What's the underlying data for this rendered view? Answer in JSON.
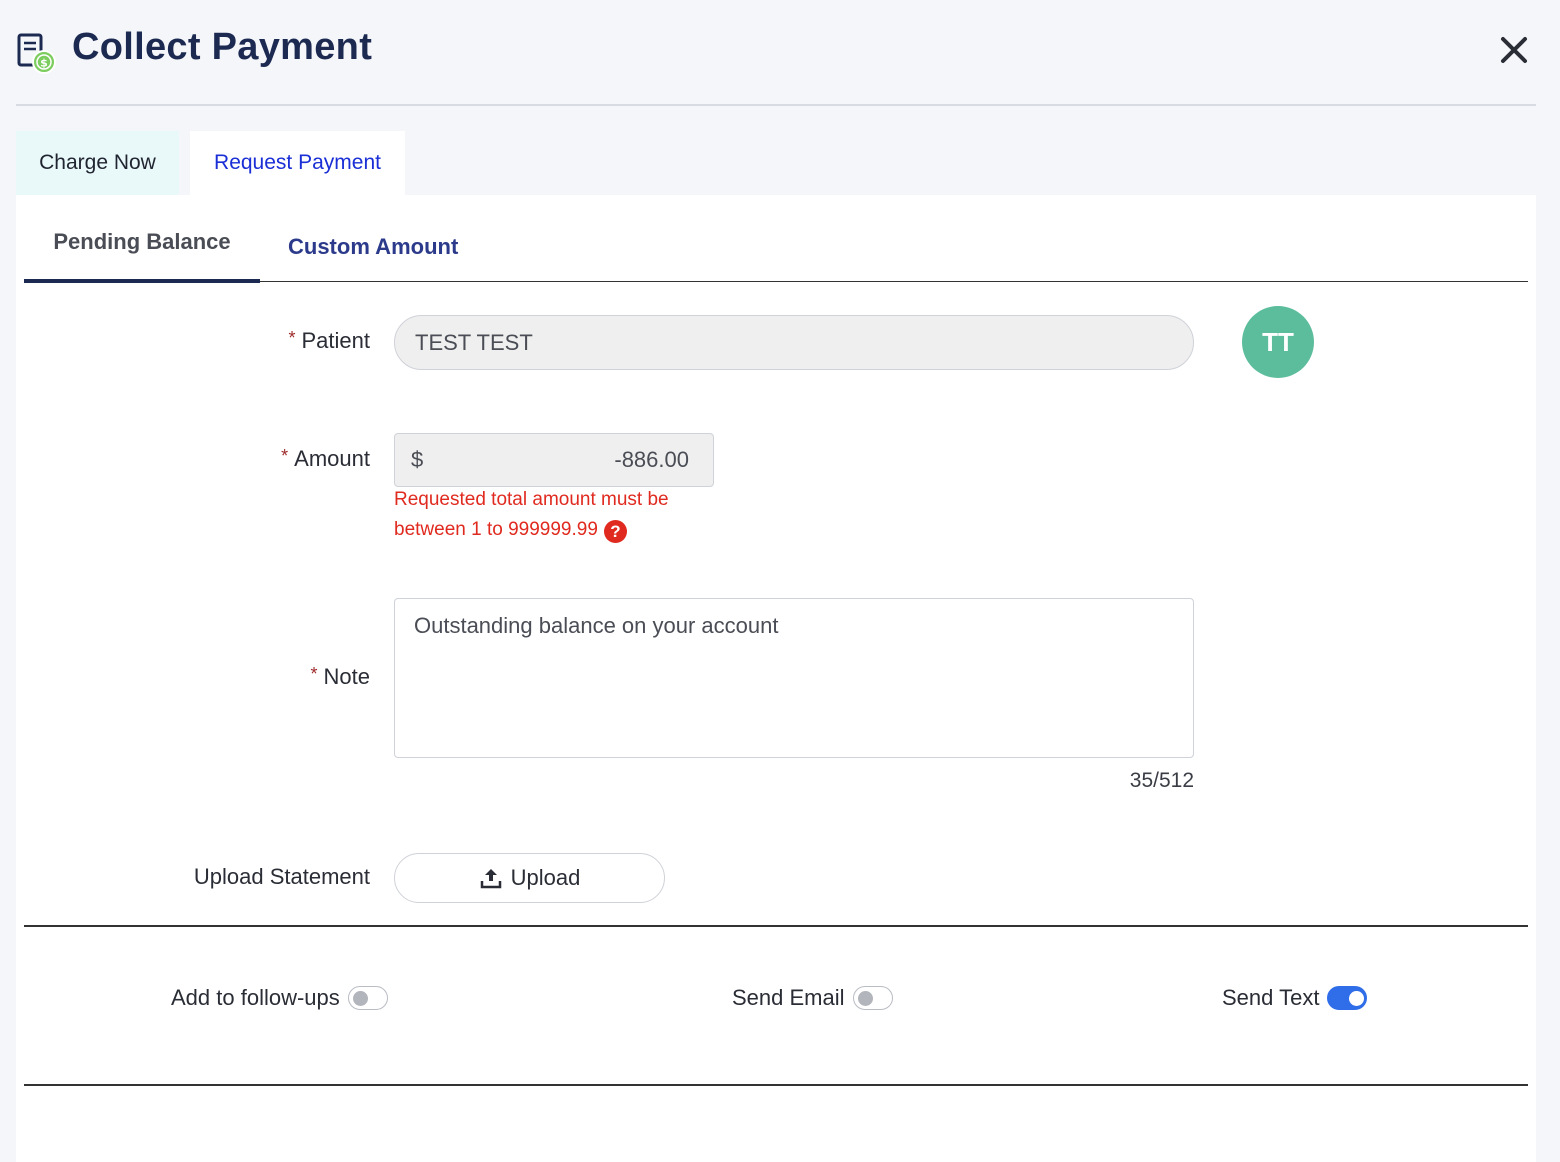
{
  "header": {
    "title": "Collect Payment",
    "icon": "payment-document-icon",
    "close_icon": "close-icon"
  },
  "tabs": [
    {
      "label": "Charge Now",
      "active": false
    },
    {
      "label": "Request Payment",
      "active": true
    }
  ],
  "subtabs": [
    {
      "label": "Pending Balance",
      "active": true
    },
    {
      "label": "Custom Amount",
      "active": false
    }
  ],
  "form": {
    "patient": {
      "label": "Patient",
      "value": "TEST TEST",
      "avatar_initials": "TT",
      "avatar_color": "#5cbd9c"
    },
    "amount": {
      "label": "Amount",
      "currency": "$",
      "value": "-886.00",
      "error_line1": "Requested total amount must be",
      "error_line2": "between 1 to 999999.99"
    },
    "note": {
      "label": "Note",
      "value": "Outstanding balance on your account",
      "counter": "35/512"
    },
    "upload": {
      "label": "Upload Statement",
      "button_label": "Upload"
    },
    "required_marker": "*"
  },
  "toggles": [
    {
      "label": "Add to follow-ups",
      "on": false
    },
    {
      "label": "Send Email",
      "on": false
    },
    {
      "label": "Send Text",
      "on": true
    }
  ],
  "colors": {
    "title": "#1c2a52",
    "active_tab_text": "#1a2fd6",
    "error": "#e02a1f",
    "toggle_on": "#2f6ee8"
  }
}
